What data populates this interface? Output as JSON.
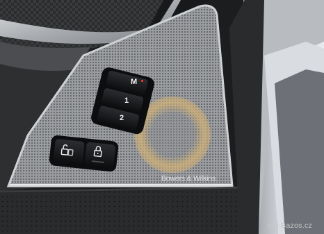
{
  "speaker": {
    "brand_text": "Bowers & Wilkins"
  },
  "memory_buttons": {
    "m_label": "M",
    "one_label": "1",
    "two_label": "2",
    "indicator_color": "#ff3b2f"
  },
  "lock_buttons": {
    "unlock_icon": "unlock-icon",
    "lock_icon": "lock-icon"
  },
  "watermark": {
    "text": "@ j.Bazos.cz"
  }
}
